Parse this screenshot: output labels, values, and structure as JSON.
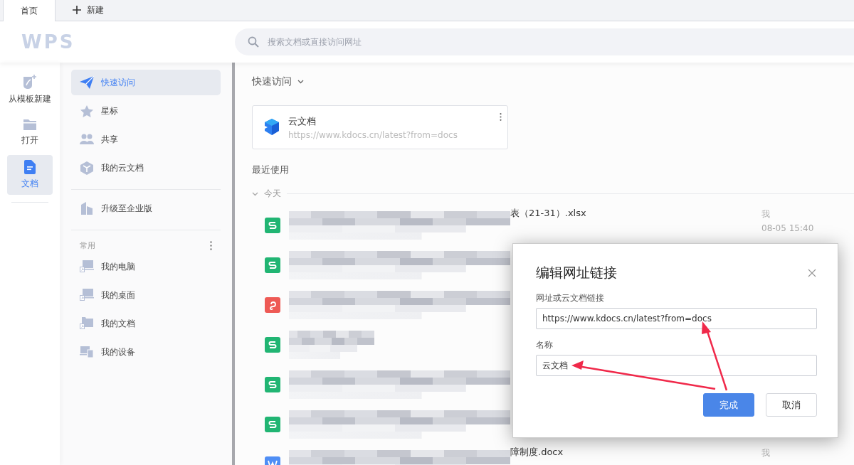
{
  "tabs": [
    {
      "label": "首页",
      "selected": true
    },
    {
      "label": "新建",
      "selected": false,
      "kind": "new"
    }
  ],
  "header": {
    "logo": "WPS",
    "search": {
      "placeholder": "搜索文档或直接访问网址"
    }
  },
  "rail": [
    {
      "label": "从模板新建",
      "kind": "template",
      "selected": false
    },
    {
      "label": "打开",
      "kind": "folder",
      "selected": false
    },
    {
      "label": "文档",
      "kind": "doc",
      "selected": true
    }
  ],
  "sidebar": {
    "items": [
      {
        "label": "快速访问",
        "kind": "send",
        "selected": true
      },
      {
        "label": "星标",
        "kind": "star",
        "selected": false
      },
      {
        "label": "共享",
        "kind": "people",
        "selected": false
      },
      {
        "label": "我的云文档",
        "kind": "cube",
        "selected": false
      }
    ],
    "upgrade": {
      "label": "升级至企业版"
    },
    "section": {
      "title": "常用",
      "items": [
        {
          "label": "我的电脑",
          "kind": "pc"
        },
        {
          "label": "我的桌面",
          "kind": "desktop"
        },
        {
          "label": "我的文档",
          "kind": "folder"
        },
        {
          "label": "我的设备",
          "kind": "devices"
        }
      ]
    }
  },
  "main": {
    "quick_title": "快速访问",
    "card": {
      "name": "云文档",
      "url": "https://www.kdocs.cn/latest?from=docs"
    },
    "recent_title": "最近使用",
    "group": "今天",
    "rows": [
      {
        "kind": "sheet",
        "name": "表（21-31）.xlsx",
        "owner": "我",
        "time": "08-05 15:40"
      },
      {
        "kind": "sheet"
      },
      {
        "kind": "pdf"
      },
      {
        "kind": "sheet"
      },
      {
        "kind": "sheet"
      },
      {
        "kind": "sheet"
      },
      {
        "kind": "doc",
        "name": "障制度.docx",
        "owner": "我"
      }
    ]
  },
  "dialog": {
    "title": "编辑网址链接",
    "fields": [
      {
        "label": "网址或云文档链接",
        "value": "https://www.kdocs.cn/latest?from=docs"
      },
      {
        "label": "名称",
        "value": "云文档"
      }
    ],
    "buttons": [
      {
        "label": "完成",
        "kind": "primary"
      },
      {
        "label": "取消",
        "kind": "secondary"
      }
    ]
  }
}
